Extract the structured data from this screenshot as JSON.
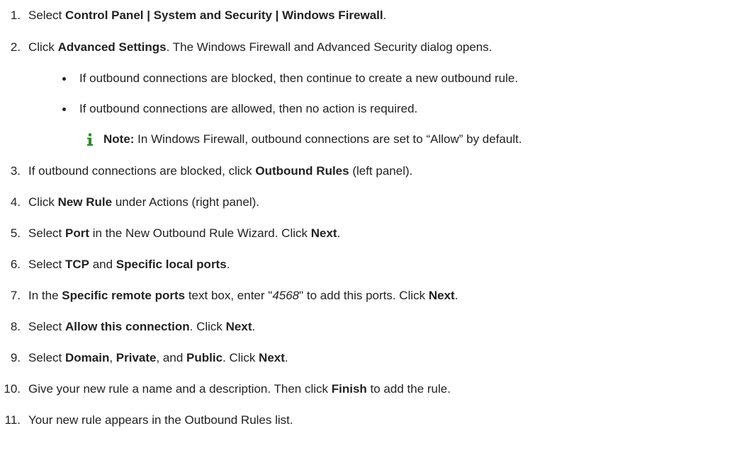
{
  "steps": [
    {
      "num": "1.",
      "parts": [
        "Select ",
        "Control Panel | System and Security | Windows Firewall",
        "."
      ]
    },
    {
      "num": "2.",
      "parts": [
        "Click ",
        "Advanced Settings",
        ". The Windows Firewall and Advanced Security dialog opens."
      ]
    },
    {
      "num": "3.",
      "parts": [
        "If outbound connections are blocked, click ",
        "Outbound Rules",
        " (left panel)."
      ]
    },
    {
      "num": "4.",
      "parts": [
        "Click ",
        "New Rule",
        " under Actions (right panel)."
      ]
    },
    {
      "num": "5.",
      "parts": [
        "Select ",
        "Port",
        " in the New Outbound Rule Wizard. Click ",
        "Next",
        "."
      ]
    },
    {
      "num": "6.",
      "parts": [
        "Select ",
        "TCP",
        " and ",
        "Specific local ports",
        "."
      ]
    },
    {
      "num": "7.",
      "parts": [
        "In the ",
        "Specific remote ports",
        " text box, enter \"",
        "4568",
        "\" to add this ports. Click ",
        "Next",
        "."
      ]
    },
    {
      "num": "8.",
      "parts": [
        "Select ",
        "Allow this connection",
        ". Click ",
        "Next",
        "."
      ]
    },
    {
      "num": "9.",
      "parts": [
        "Select ",
        "Domain",
        ", ",
        "Private",
        ", and ",
        "Public",
        ". Click ",
        "Next",
        "."
      ]
    },
    {
      "num": "10.",
      "parts": [
        "Give your new rule a name and a description. Then click ",
        "Finish",
        " to add the rule."
      ]
    },
    {
      "num": "11.",
      "parts": [
        "Your new rule appears in the Outbound Rules list."
      ]
    }
  ],
  "bullets": [
    "If outbound connections are blocked, then continue to create a new outbound rule.",
    "If outbound connections are allowed, then no action is required."
  ],
  "note": {
    "label": "Note:",
    "text": " In Windows Firewall, outbound connections are set to “Allow” by default."
  },
  "icons": {
    "note_icon": "info-icon",
    "bullet": "bullet-dot"
  },
  "colors": {
    "text": "#222222",
    "info_icon": "#2d8a2d",
    "background": "#ffffff"
  }
}
